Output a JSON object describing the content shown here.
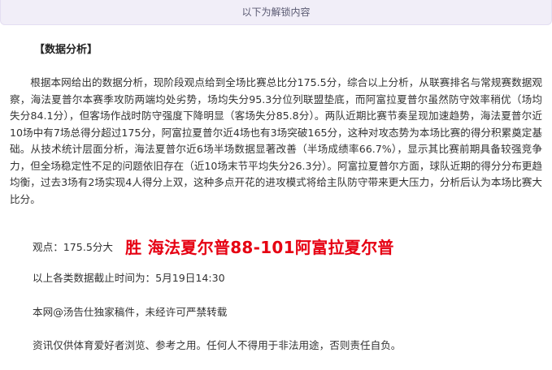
{
  "banner": {
    "text": "以下为解锁内容"
  },
  "article": {
    "section_title": "【数据分析】",
    "analysis_paragraph": "根据本网给出的数据分析，现阶段观点给到全场比赛总比分175.5分，综合以上分析，从联赛排名与常规赛数据观察，海法夏普尔本赛季攻防两端均处劣势，场均失分95.3分位列联盟垫底，而阿富拉夏普尔虽然防守效率稍优（场均失分84.1分），但客场作战时防守强度下降明显（客场失分85.8分）。两队近期比赛节奏呈现加速趋势，海法夏普尔近10场中有7场总得分超过175分，阿富拉夏普尔近4场也有3场突破165分，这种对攻态势为本场比赛的得分积累奠定基础。从技术统计层面分析，海法夏普尔近6场半场数据显著改善（半场成绩率66.7%），显示其比赛前期具备较强竞争力，但全场稳定性不足的问题依旧存在（近10场末节平均失分26.3分）。阿富拉夏普尔方面，球队近期的得分分布更趋均衡，过去3场有2场实现4人得分上双，这种多点开花的进攻模式将给主队防守带来更大压力，分析后认为本场比赛大比分。",
    "viewpoint_label": "观点：175.5分大",
    "prediction": "胜  海法夏尔普88-101阿富拉夏尔普",
    "cutoff_time": "以上各类数据截止时间为：5月19日14:30",
    "copyright": "本网@汤告仕独家稿件，未经许可严禁转载",
    "disclaimer": "资讯仅供体育爱好者浏览、参考之用。任何人不得用于非法用途，否则责任自负。"
  },
  "colors": {
    "banner_background": "#f1eef8",
    "prediction_red": "#e60012",
    "body_text": "#333333"
  }
}
